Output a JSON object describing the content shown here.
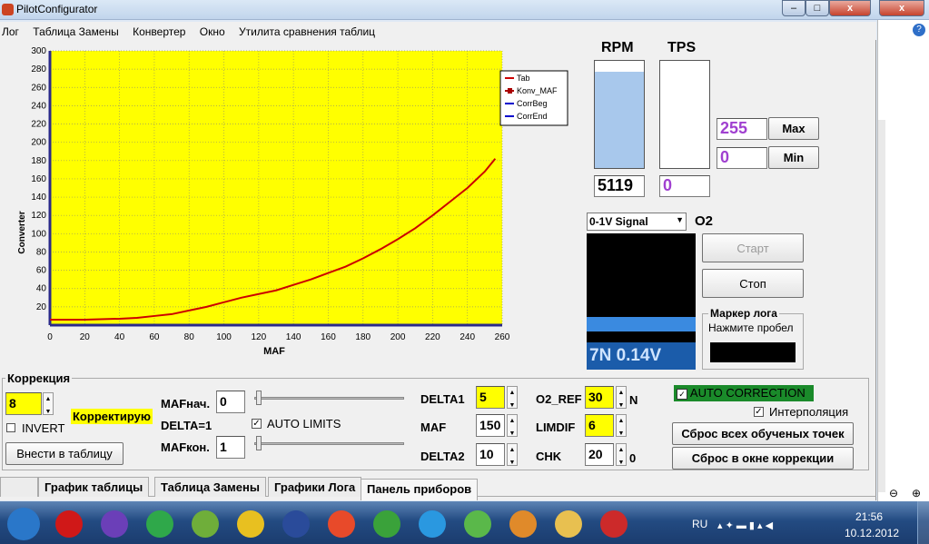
{
  "window": {
    "title": "PilotConfigurator",
    "min_glyph": "–",
    "max_glyph": "□",
    "close_glyph": "x"
  },
  "menu": {
    "items": [
      "Лог",
      "Таблица Замены",
      "Конвертер",
      "Окно",
      "Утилита сравнения таблиц"
    ]
  },
  "chart_data": {
    "type": "line",
    "xlabel": "MAF",
    "ylabel": "Converter",
    "xlim": [
      0,
      260
    ],
    "ylim": [
      0,
      300
    ],
    "x_ticks": [
      0,
      20,
      40,
      60,
      80,
      100,
      120,
      140,
      160,
      180,
      200,
      220,
      240,
      260
    ],
    "y_ticks": [
      20,
      40,
      60,
      80,
      100,
      120,
      140,
      160,
      180,
      200,
      220,
      240,
      260,
      280,
      300
    ],
    "grid": true,
    "background": "#ffff00",
    "legend_position": "top-right",
    "legend": [
      "Tab",
      "Konv_MAF",
      "CorrBeg",
      "CorrEnd"
    ],
    "series": [
      {
        "name": "Tab",
        "color": "#cc0000",
        "x": [
          0,
          20,
          40,
          50,
          60,
          70,
          80,
          90,
          100,
          110,
          120,
          130,
          140,
          150,
          160,
          170,
          180,
          190,
          200,
          210,
          220,
          230,
          240,
          250,
          256
        ],
        "y": [
          6,
          6,
          7,
          8,
          10,
          12,
          16,
          20,
          25,
          30,
          34,
          38,
          44,
          50,
          57,
          64,
          73,
          83,
          94,
          106,
          120,
          135,
          150,
          168,
          182
        ]
      }
    ]
  },
  "gauges": {
    "rpm": {
      "label": "RPM",
      "value": "5119",
      "fill": 0.9
    },
    "tps": {
      "label": "TPS",
      "value": "0",
      "fill": 0
    },
    "max": {
      "value": "255",
      "button": "Max"
    },
    "min": {
      "value": "0",
      "button": "Min"
    }
  },
  "o2": {
    "select": "0-1V Signal",
    "label": "O2",
    "readout": "7N 0.14V",
    "bar_level": 0.12
  },
  "controls": {
    "start": "Старт",
    "stop": "Стоп",
    "marker_title": "Маркер лога",
    "marker_hint": "Нажмите пробел"
  },
  "correction": {
    "group_label": "Коррекция",
    "value": "8",
    "invert_label": "INVERT",
    "status": "Корректирую",
    "apply_button": "Внести в таблицу",
    "maf_start_label": "MAFнач.",
    "maf_start_value": "0",
    "delta_label": "DELTA=1",
    "auto_limits_label": "AUTO LIMITS",
    "maf_end_label": "MAFкон.",
    "maf_end_value": "1",
    "delta1_label": "DELTA1",
    "delta1_value": "5",
    "maf_label": "MAF",
    "maf_value": "150",
    "delta2_label": "DELTA2",
    "delta2_value": "10",
    "o2ref_label": "O2_REF",
    "o2ref_value": "30",
    "o2ref_unit": "N",
    "limdif_label": "LIMDIF",
    "limdif_value": "6",
    "chk_label": "CHK",
    "chk_value": "20",
    "chk_unit": "0",
    "auto_correction_label": "AUTO CORRECTION",
    "interpolation_label": "Интерполяция",
    "reset_all_button": "Сброс всех обученых точек",
    "reset_window_button": "Сброс  в  окне коррекции"
  },
  "tabs": [
    "График таблицы",
    "Таблица Замены",
    "Графики Лога",
    "Панель приборов"
  ],
  "taskbar": {
    "lang": "RU",
    "time": "21:56",
    "date": "10.12.2012",
    "apps": [
      "start-orb-icon",
      "opera-icon",
      "vlc-like-icon",
      "download-icon",
      "notepad-icon",
      "batman-icon",
      "save-icon",
      "chrome-icon",
      "utorrent-icon",
      "skype-icon",
      "network-icon",
      "media-icon",
      "folder-icon",
      "pilot-car-icon"
    ]
  }
}
